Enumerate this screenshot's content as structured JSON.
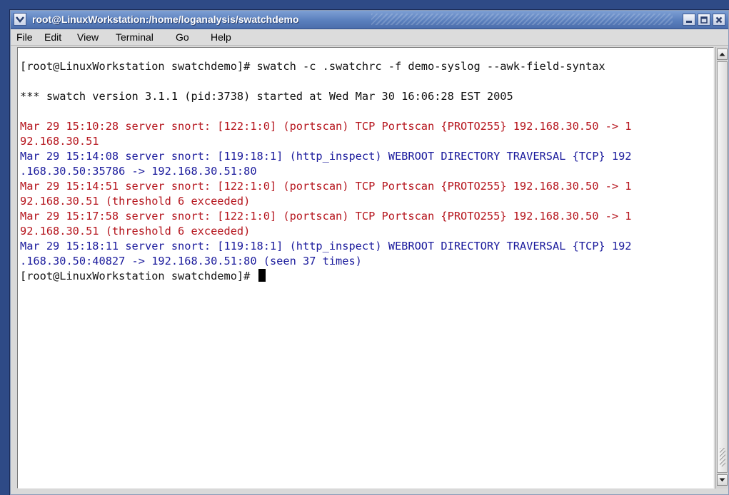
{
  "window": {
    "title": "root@LinuxWorkstation:/home/loganalysis/swatchdemo"
  },
  "menu": {
    "file": "File",
    "edit": "Edit",
    "view": "View",
    "terminal": "Terminal",
    "go": "Go",
    "help": "Help"
  },
  "terminal": {
    "lines": [
      {
        "text": "[root@LinuxWorkstation swatchdemo]# swatch -c .swatchrc -f demo-syslog --awk-field-syntax",
        "color": "black"
      },
      {
        "text": "",
        "color": "black"
      },
      {
        "text": "*** swatch version 3.1.1 (pid:3738) started at Wed Mar 30 16:06:28 EST 2005",
        "color": "black"
      },
      {
        "text": "",
        "color": "black"
      },
      {
        "text": "Mar 29 15:10:28 server snort: [122:1:0] (portscan) TCP Portscan {PROTO255} 192.168.30.50 -> 1",
        "color": "red"
      },
      {
        "text": "92.168.30.51",
        "color": "red"
      },
      {
        "text": "Mar 29 15:14:08 server snort: [119:18:1] (http_inspect) WEBROOT DIRECTORY TRAVERSAL {TCP} 192",
        "color": "blue"
      },
      {
        "text": ".168.30.50:35786 -> 192.168.30.51:80",
        "color": "blue"
      },
      {
        "text": "Mar 29 15:14:51 server snort: [122:1:0] (portscan) TCP Portscan {PROTO255} 192.168.30.50 -> 1",
        "color": "red"
      },
      {
        "text": "92.168.30.51 (threshold 6 exceeded)",
        "color": "red"
      },
      {
        "text": "Mar 29 15:17:58 server snort: [122:1:0] (portscan) TCP Portscan {PROTO255} 192.168.30.50 -> 1",
        "color": "red"
      },
      {
        "text": "92.168.30.51 (threshold 6 exceeded)",
        "color": "red"
      },
      {
        "text": "Mar 29 15:18:11 server snort: [119:18:1] (http_inspect) WEBROOT DIRECTORY TRAVERSAL {TCP} 192",
        "color": "blue"
      },
      {
        "text": ".168.30.50:40827 -> 192.168.30.51:80 (seen 37 times)",
        "color": "blue"
      },
      {
        "text": "[root@LinuxWorkstation swatchdemo]# ",
        "color": "black"
      }
    ]
  },
  "colors": {
    "red": "#b5141c",
    "blue": "#1a1a9c",
    "black": "#111111",
    "titlebar": "#5a7fbd"
  },
  "icons": {
    "window_menu": "chevron-down-icon",
    "minimize": "minimize-icon",
    "maximize": "maximize-icon",
    "close": "close-icon",
    "scroll_up": "arrow-up-icon",
    "scroll_down": "arrow-down-icon"
  }
}
